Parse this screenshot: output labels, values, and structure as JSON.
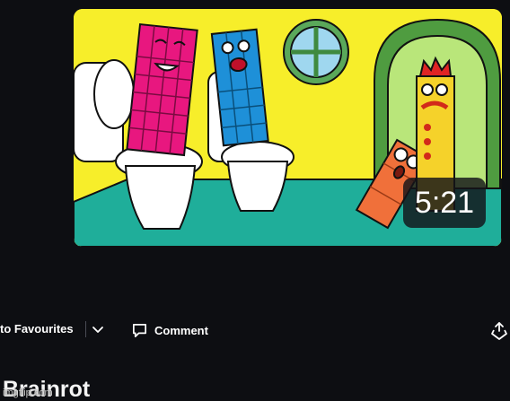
{
  "video": {
    "duration": "5:21",
    "title": "Brainrot"
  },
  "actions": {
    "favourites_label": "to Favourites",
    "comment_label": "Comment"
  },
  "watermark": "imgflip.com",
  "colors": {
    "background": "#0d0e12",
    "text": "#ffffff",
    "thumbnail_wall": "#f7ee2a",
    "thumbnail_floor": "#1fae9a"
  },
  "icons": [
    "chevron-down-icon",
    "comment-icon",
    "share-icon"
  ]
}
